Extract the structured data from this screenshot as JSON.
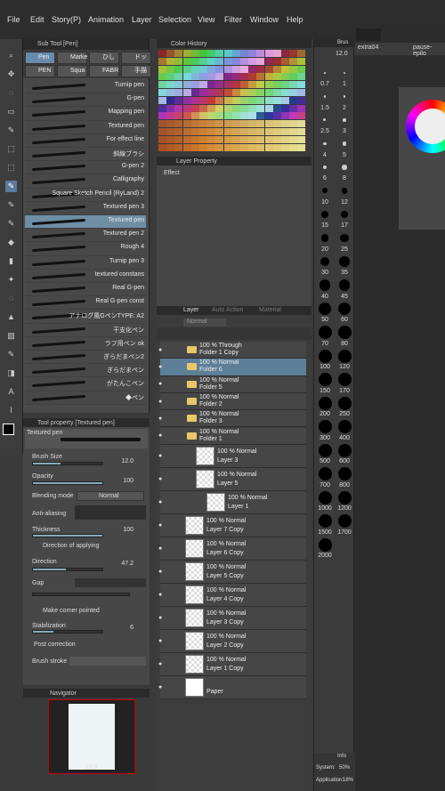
{
  "menu": [
    "File",
    "Edit",
    "Story(P)",
    "Animation",
    "Layer",
    "Selection",
    "View",
    "Filter",
    "Window",
    "Help"
  ],
  "tabs": {
    "docs": [
      "extra04",
      "pause-epilo"
    ],
    "brush_panel": "Brus"
  },
  "subtool": {
    "title": "Sub Tool [Pen]",
    "tabs": [
      "Pen",
      "Marke",
      "ひし",
      "ドット",
      "PEN",
      "Squa",
      "FABR",
      "手描"
    ],
    "brushes": [
      "Turnip pen",
      "G-pen",
      "Mapping pen",
      "Textured pen",
      "For effect line",
      "斜線ブラシ",
      "G-pen 2",
      "Calligraphy",
      "Square Sketch Pencil (RyLand) 2",
      "Textured pen 3",
      "Textured pen",
      "Textured pen 2",
      "Rough 4",
      "Turnip pen 3",
      "textured constans",
      "Real G-pen",
      "Real G-pen const",
      "アナログ風GペンTYPE: A2",
      "干支化ペン",
      "ラフ用ペン ok",
      "ぎらだまペン2",
      "ぎらだまペン",
      "がたんこペン",
      "◆ペン"
    ]
  },
  "toolprop": {
    "title": "Tool property [Textured pen]",
    "brush_name": "Textured pen",
    "brush_size": "12.0",
    "opacity": "100",
    "blending_label": "Blending mode",
    "blending_value": "Normal",
    "anti_aliasing": "Anti-aliasing",
    "thickness": "Thickness",
    "thickness_val": "100",
    "direction_applying": "Direction of applying",
    "direction": "Direction",
    "direction_val": "47.2",
    "gap": "Gap",
    "corner": "Make corner pointed",
    "stabilization": "Stabilization",
    "stab_val": "6",
    "post": "Post correction",
    "brush_stroke": "Brush stroke",
    "labels": {
      "size": "Brush Size",
      "opacity": "Opacity"
    }
  },
  "navigator": {
    "title": "Navigator",
    "zoom": "19.3"
  },
  "color_history": {
    "title": "Color History"
  },
  "layer_property": {
    "title": "Layer Property",
    "effect": "Effect"
  },
  "layer": {
    "tabs": [
      "Layer",
      "Auto Action",
      "Material"
    ],
    "blend": "Normal",
    "rows": [
      {
        "mode": "100 % Through",
        "name": "Folder 1 Copy",
        "type": "folder"
      },
      {
        "mode": "100 % Normal",
        "name": "Folder 6",
        "type": "folder",
        "sel": true
      },
      {
        "mode": "100 % Normal",
        "name": "Folder 5",
        "type": "folder"
      },
      {
        "mode": "100 % Normal",
        "name": "Folder 2",
        "type": "folder"
      },
      {
        "mode": "100 % Normal",
        "name": "Folder 3",
        "type": "folder"
      },
      {
        "mode": "100 % Normal",
        "name": "Folder 1",
        "type": "folder"
      },
      {
        "mode": "100 % Normal",
        "name": "Layer 3",
        "type": "layer",
        "indent": 1
      },
      {
        "mode": "100 % Normal",
        "name": "Layer 5",
        "type": "layer",
        "indent": 1
      },
      {
        "mode": "100 % Normal",
        "name": "Layer 1",
        "type": "layer",
        "indent": 2
      },
      {
        "mode": "100 % Normal",
        "name": "Layer 7 Copy",
        "type": "layer"
      },
      {
        "mode": "100 % Normal",
        "name": "Layer 6 Copy",
        "type": "layer"
      },
      {
        "mode": "100 % Normal",
        "name": "Layer 5 Copy",
        "type": "layer"
      },
      {
        "mode": "100 % Normal",
        "name": "Layer 4 Copy",
        "type": "layer"
      },
      {
        "mode": "100 % Normal",
        "name": "Layer 3 Copy",
        "type": "layer"
      },
      {
        "mode": "100 % Normal",
        "name": "Layer 2 Copy",
        "type": "layer"
      },
      {
        "mode": "100 % Normal",
        "name": "Layer 1 Copy",
        "type": "layer"
      },
      {
        "mode": "",
        "name": "Paper",
        "type": "paper"
      }
    ]
  },
  "brush_sizes": {
    "current": "12.0",
    "values": [
      "0.7",
      "1",
      "1.5",
      "2",
      "2.5",
      "3",
      "4",
      "5",
      "6",
      "8",
      "10",
      "12",
      "15",
      "17",
      "20",
      "25",
      "30",
      "35",
      "40",
      "45",
      "50",
      "60",
      "70",
      "80",
      "100",
      "120",
      "150",
      "170",
      "200",
      "250",
      "300",
      "400",
      "500",
      "600",
      "700",
      "800",
      "1000",
      "1200",
      "1500",
      "1700",
      "2000"
    ]
  },
  "info": {
    "title": "Info",
    "system_label": "System:",
    "system": "50%",
    "app_label": "Application:",
    "app": "18%"
  }
}
